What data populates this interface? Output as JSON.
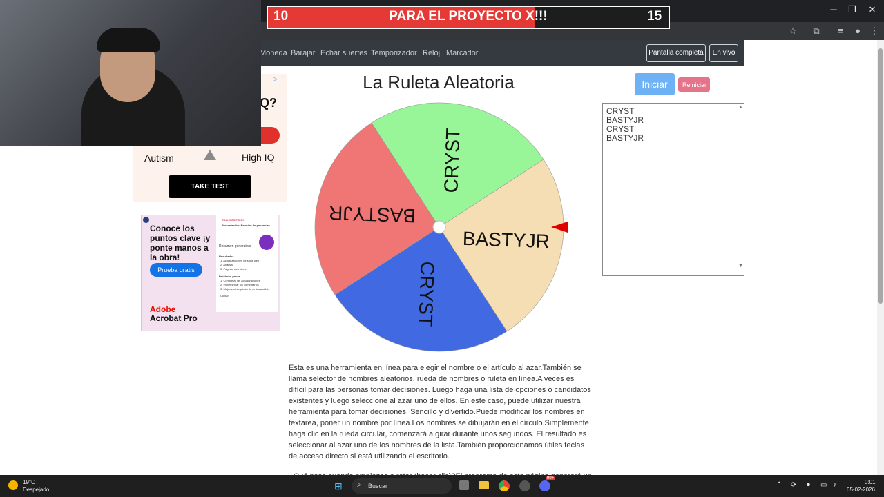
{
  "browser": {
    "toolbar_icons": [
      "star-icon",
      "extensions-icon",
      "tab-search-icon",
      "profile-icon",
      "menu-icon"
    ]
  },
  "overlay": {
    "counter": {
      "left": "10",
      "message": "PARA EL PROYECTO X!!!",
      "right": "15",
      "progress": 0.667
    }
  },
  "nav": {
    "links": [
      "Moneda",
      "Barajar",
      "Echar suertes",
      "Temporizador",
      "Reloj",
      "Marcador"
    ],
    "fullscreen_label": "Pantalla completa",
    "live_label": "En vivo"
  },
  "ads": {
    "ad1": {
      "question_text": "Q?",
      "left_label": "Autism",
      "right_label": "High IQ",
      "cta": "TAKE TEST"
    },
    "ad2": {
      "headline": "Conoce los puntos clave ¡y ponte manos a la obra!",
      "cta": "Prueba gratis",
      "brand": "Adobe",
      "product": "Acrobat Pro",
      "panel_tag": "TRANSCRIPCIÓN",
      "panel_title": "Presentación: Reunión de ganancias",
      "panel_summary": "Resumen generativo",
      "panel_results": "Resultados",
      "panel_results_items": [
        "1. Actualizaciones de sitios web",
        "2. Análisis",
        "3. Páginas web clave"
      ],
      "panel_next": "Próximos pasos",
      "panel_next_items": [
        "1. Completar las actualizaciones",
        "2. Implementar los comentarios",
        "3. Mejorar el seguimiento de los análisis"
      ],
      "panel_copy": "Copiar"
    }
  },
  "main": {
    "title": "La Ruleta Aleatoria",
    "start_label": "Iniciar",
    "reset_label": "Reiniciar",
    "names_text": "CRYST\nBASTYJR\nCRYST\nBASTYJR",
    "description": "Esta es una herramienta en línea para elegir el nombre o el artículo al azar.También se llama selector de nombres aleatorios, rueda de nombres o ruleta en línea.A veces es difícil para las personas tomar decisiones. Luego haga una lista de opciones o candidatos existentes y luego seleccione al azar uno de ellos. En este caso, puede utilizar nuestra herramienta para tomar decisiones. Sencillo y divertido.Puede modificar los nombres en textarea, poner un nombre por línea.Los nombres se dibujarán en el círculo.Simplemente haga clic en la rueda circular, comenzará a girar durante unos segundos. El resultado es seleccionar al azar uno de los nombres de la lista.También proporcionamos útiles teclas de acceso directo si está utilizando el escritorio.",
    "description_more": "¿Qué pasa cuando empiezas a rotar (hacer clic)?El programa de esta página generará un"
  },
  "wheel": {
    "segments": [
      {
        "label": "BASTYJR",
        "color": "#f5deb3"
      },
      {
        "label": "CRYST",
        "color": "#4169e1"
      },
      {
        "label": "BASTYJR",
        "color": "#f07575"
      },
      {
        "label": "CRYST",
        "color": "#98f598"
      }
    ],
    "pointer_color": "#e00000"
  },
  "taskbar": {
    "weather_temp": "19°C",
    "weather_desc": "Despejado",
    "search_placeholder": "Buscar",
    "time": "0:01",
    "date": "05-02-2026",
    "discord_badge": "99+"
  }
}
